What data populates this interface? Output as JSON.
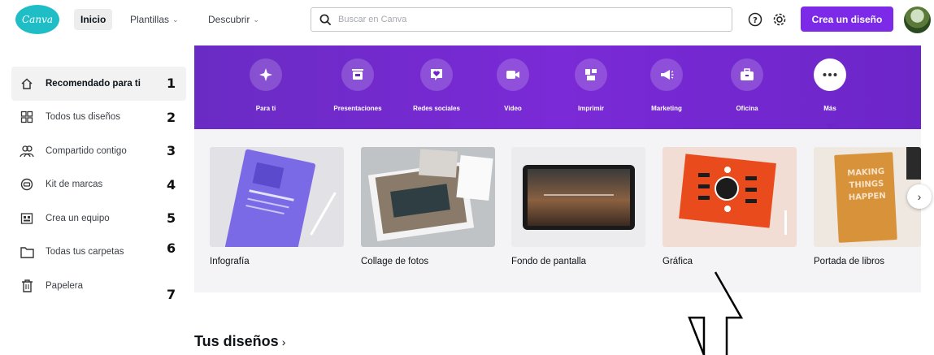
{
  "header": {
    "logo_text": "Canva",
    "nav": [
      {
        "label": "Inicio",
        "active": true
      },
      {
        "label": "Plantillas",
        "dropdown": true
      },
      {
        "label": "Descubrir",
        "dropdown": true
      }
    ],
    "search_placeholder": "Buscar en Canva",
    "create_button": "Crea un diseño",
    "accent_color": "#7d2ae8"
  },
  "sidebar": {
    "items": [
      {
        "label": "Recomendado para ti",
        "icon": "home-icon",
        "number": "1",
        "active": true
      },
      {
        "label": "Todos tus diseños",
        "icon": "grid-icon",
        "number": "2"
      },
      {
        "label": "Compartido contigo",
        "icon": "shared-users-icon",
        "number": "3"
      },
      {
        "label": "Kit de marcas",
        "icon": "brand-kit-icon",
        "number": "4"
      },
      {
        "label": "Crea un equipo",
        "icon": "team-icon",
        "number": "5"
      },
      {
        "label": "Todas tus carpetas",
        "icon": "folder-icon",
        "number": "6"
      },
      {
        "label": "Papelera",
        "icon": "trash-icon",
        "number": "7"
      }
    ]
  },
  "categories": [
    {
      "label": "Para ti",
      "icon": "sparkle-icon"
    },
    {
      "label": "Presentaciones",
      "icon": "presentation-icon"
    },
    {
      "label": "Redes sociales",
      "icon": "heart-chat-icon"
    },
    {
      "label": "Video",
      "icon": "video-camera-icon"
    },
    {
      "label": "Imprimir",
      "icon": "print-icon"
    },
    {
      "label": "Marketing",
      "icon": "megaphone-icon"
    },
    {
      "label": "Oficina",
      "icon": "briefcase-icon"
    },
    {
      "label": "Más",
      "icon": "more-dots-icon",
      "selected": true
    }
  ],
  "templates": [
    {
      "label": "Infografía"
    },
    {
      "label": "Collage de fotos"
    },
    {
      "label": "Fondo de pantalla"
    },
    {
      "label": "Gráfica"
    },
    {
      "label": "Portada de libros"
    }
  ],
  "thumb_text": {
    "book_lines": [
      "MAKING",
      "THINGS",
      "HAPPEN"
    ]
  },
  "section": {
    "title": "Tus diseños"
  }
}
